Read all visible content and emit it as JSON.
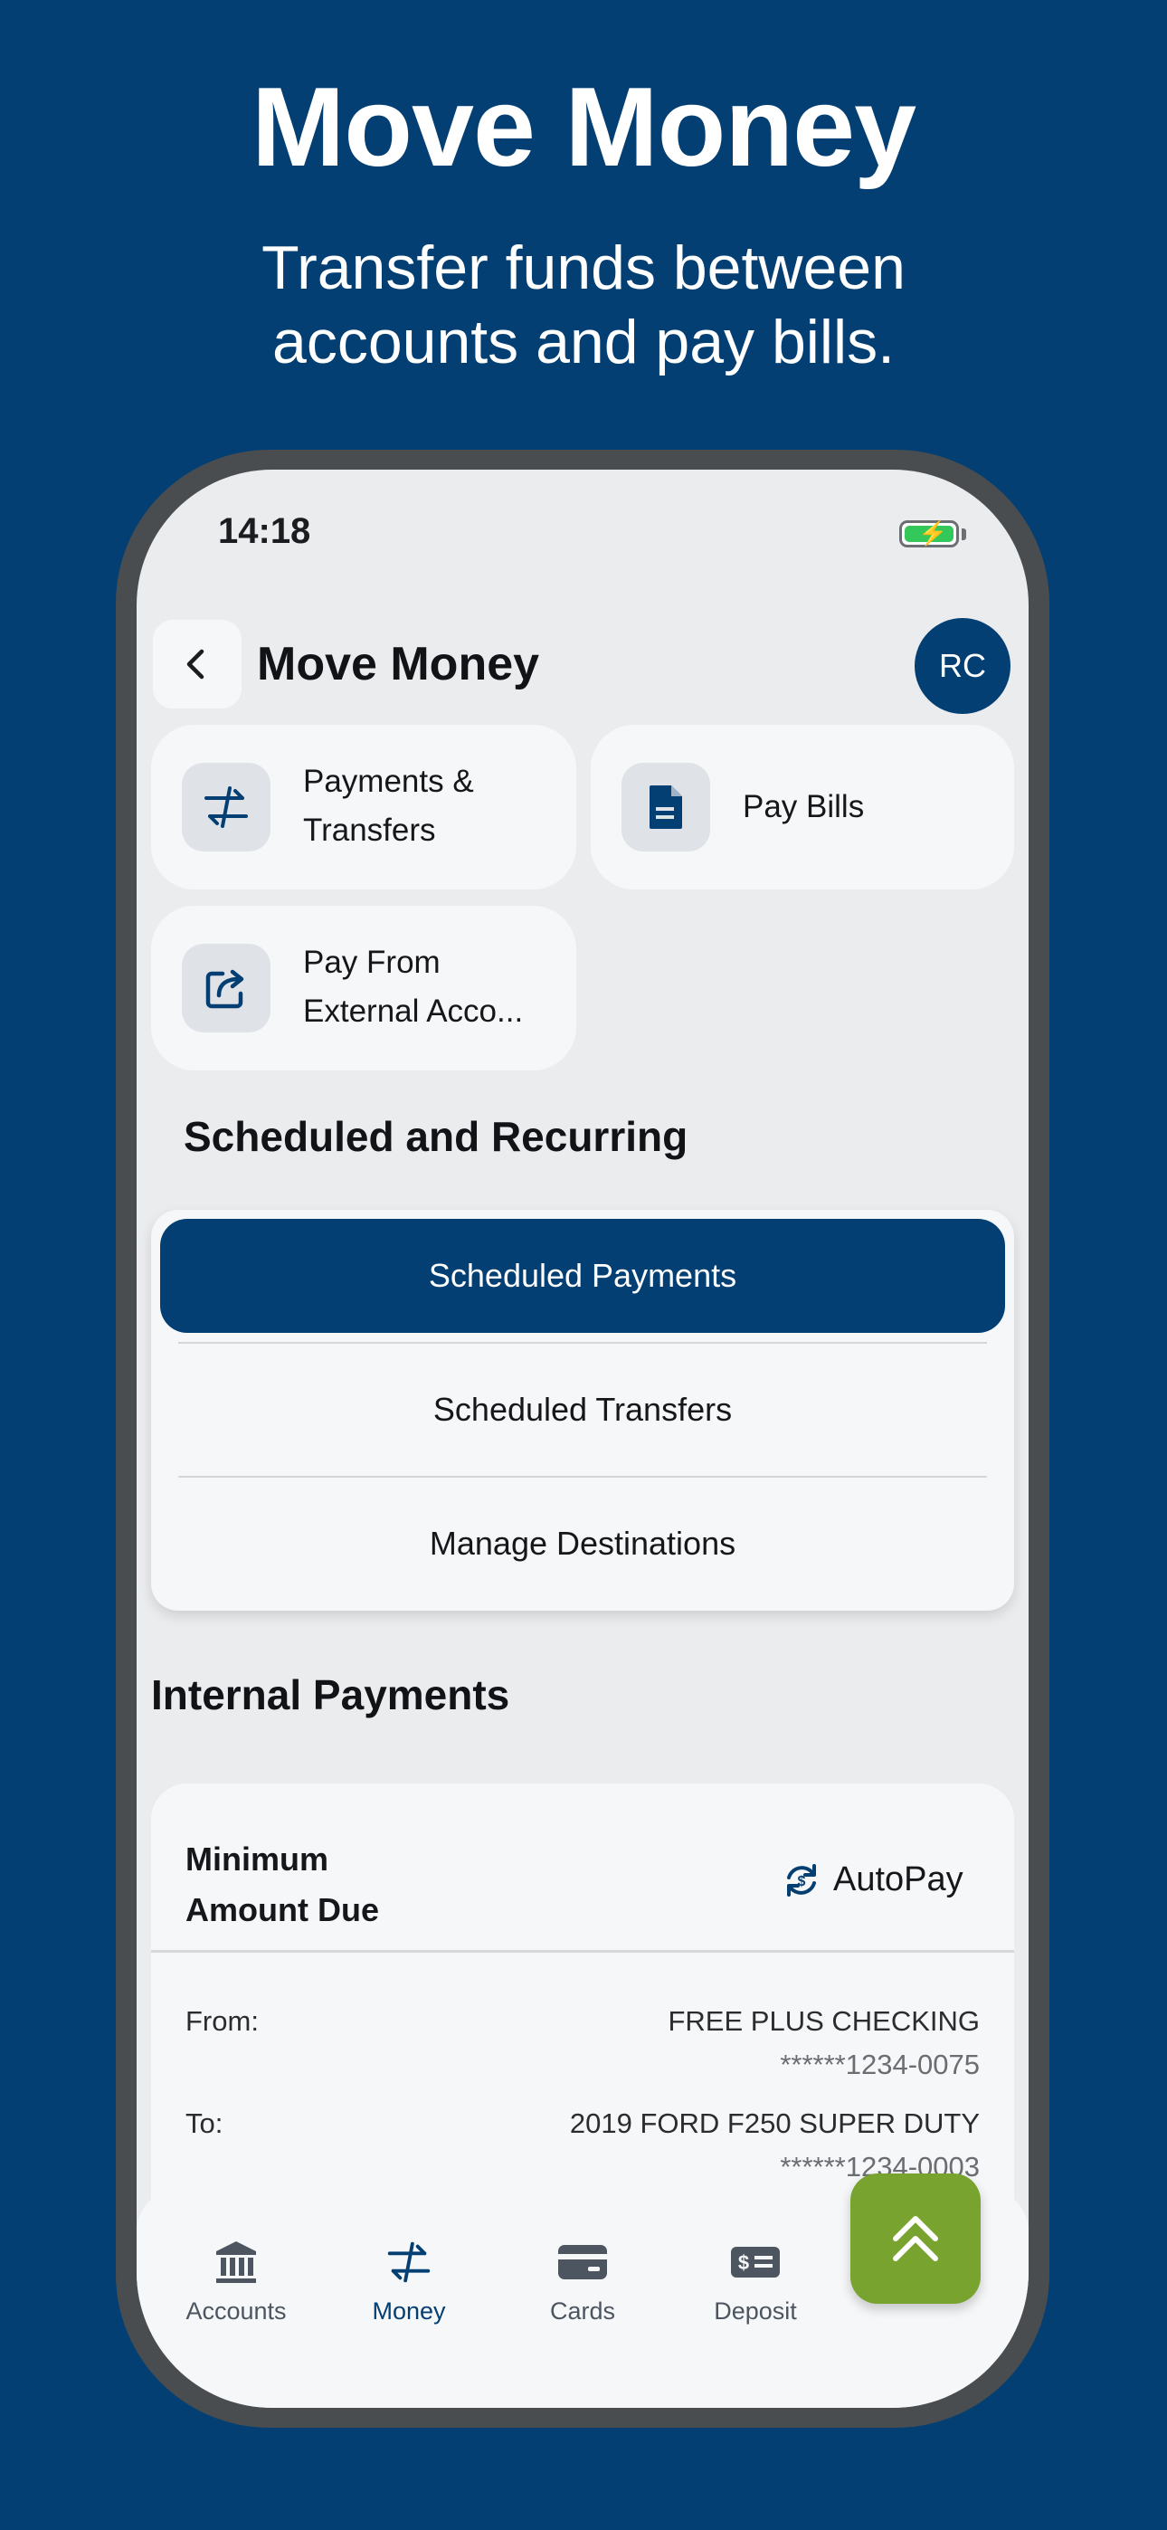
{
  "hero": {
    "title": "Move Money",
    "subtitle_line1": "Transfer funds between",
    "subtitle_line2": "accounts and pay bills."
  },
  "status_bar": {
    "time": "14:18",
    "battery_charging": true
  },
  "header": {
    "back_icon": "chevron-left-icon",
    "title": "Move Money",
    "avatar_initials": "RC"
  },
  "actions": [
    {
      "label_line1": "Payments &",
      "label_line2": "Transfers",
      "icon": "transfer-arrows-icon"
    },
    {
      "label_line1": "Pay Bills",
      "label_line2": "",
      "icon": "document-icon"
    },
    {
      "label_line1": "Pay From",
      "label_line2": "External Acco...",
      "icon": "share-external-icon"
    }
  ],
  "scheduled": {
    "title": "Scheduled and Recurring",
    "items": [
      "Scheduled Payments",
      "Scheduled Transfers",
      "Manage Destinations"
    ],
    "active_index": 0
  },
  "internal_payments": {
    "title": "Internal Payments",
    "card": {
      "type_line1": "Minimum",
      "type_line2": "Amount Due",
      "autopay_label": "AutoPay",
      "from_label": "From:",
      "from_name": "FREE PLUS CHECKING",
      "from_account": "******1234-0075",
      "to_label": "To:",
      "to_name": "2019 FORD F250 SUPER DUTY",
      "to_account": "******1234-0003"
    }
  },
  "tabbar": {
    "tabs": [
      {
        "label": "Accounts",
        "icon": "bank-icon"
      },
      {
        "label": "Money",
        "icon": "transfer-arrows-icon"
      },
      {
        "label": "Cards",
        "icon": "credit-card-icon"
      },
      {
        "label": "Deposit",
        "icon": "check-deposit-icon"
      }
    ],
    "active_index": 1
  },
  "colors": {
    "brand": "#033f73",
    "fab": "#79a32f",
    "background": "#ebecee"
  }
}
